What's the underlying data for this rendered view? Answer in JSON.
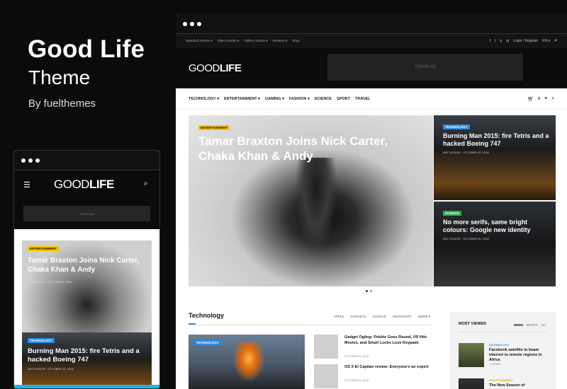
{
  "promo": {
    "title": "Good Life",
    "subtitle": "Theme",
    "by": "By fuelthemes"
  },
  "desktop": {
    "topbar": {
      "links": [
        "Standard Articles ▾",
        "Video Articles ▾",
        "Gallery Articles ▾",
        "Reviews ▾",
        "Shop"
      ],
      "social": [
        "f",
        "t",
        "p",
        "ig"
      ],
      "login": "Login / Register",
      "lang": "EN ▾"
    },
    "logo": {
      "light": "GOOD",
      "bold": "LIFE"
    },
    "ad": "728X90 AD",
    "menu": [
      "TECHNOLOGY ▾",
      "ENTERTAINMENT ▾",
      "GAMING ▾",
      "FASHION ▾",
      "SCIENCE",
      "SPORT",
      "TRAVEL"
    ],
    "cart_count": "0",
    "hero": {
      "main": {
        "badge": "ENTERTAINMENT",
        "title": "Tamar Braxton Joins Nick Carter, Chaka Khan & Andy",
        "meta": "ANT EKSLER · OCTOBER 6, 2016"
      },
      "side1": {
        "badge": "TECHNOLOGY",
        "title": "Burning Man 2015: fire Tetris and a hacked Boeing 747",
        "meta": "ANT EKSLER · OCTOBER 20, 2016"
      },
      "side2": {
        "badge": "SCIENCE",
        "title": "No more serifs, same bright colours: Google new identity",
        "meta": "ANT EKSLER · OCTOBER 20, 2016"
      }
    },
    "technology": {
      "heading": "Technology",
      "tabs": [
        "APPLE",
        "GADGETS",
        "GOOGLE",
        "MICROSOFT",
        "MORE ▾"
      ],
      "big_badge": "TECHNOLOGY",
      "items": [
        {
          "title": "Gadget Ogling: Pebble Goes Round, VR Hits Movies, and Smart Locks Lose Keypads",
          "date": "OCTOBER 6, 2016"
        },
        {
          "title": "OS X El Capitan review: Everyone's an expert",
          "date": "OCTOBER 6, 2016"
        }
      ]
    },
    "most_viewed": {
      "heading": "MOST VIEWED",
      "options": [
        "WEEK",
        "MONTH",
        "ALL"
      ],
      "items": [
        {
          "category": "TECHNOLOGY",
          "title": "Facebook satellite to beam internet to remote regions in Africa",
          "views": "1 VIEWS"
        },
        {
          "category": "ENTERTAINMENT",
          "title": "The New Season of"
        }
      ]
    }
  },
  "mobile": {
    "logo": {
      "light": "GOOD",
      "bold": "LIFE"
    },
    "ad": "728X90 AD",
    "card1": {
      "badge": "ENTERTAINMENT",
      "title": "Tamar Braxton Joins Nick Carter, Chaka Khan & Andy",
      "meta": "ANT EKSLER · OCTOBER 6, 2016"
    },
    "card2": {
      "badge": "TECHNOLOGY",
      "title": "Burning Man 2015: fire Tetris and a hacked Boeing 747",
      "meta": "ANT EKSLER · OCTOBER 20, 2016"
    }
  }
}
